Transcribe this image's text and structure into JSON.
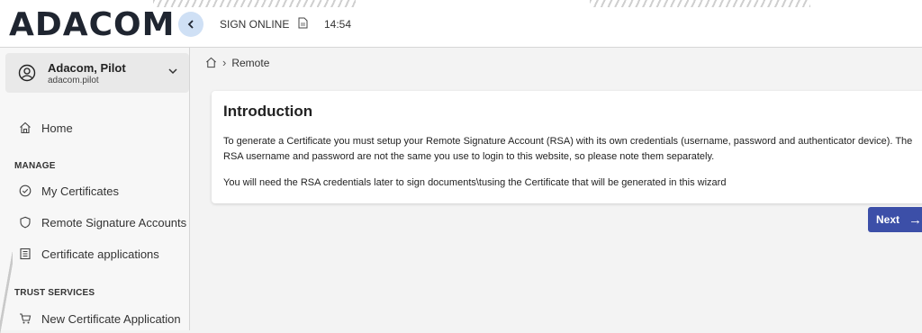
{
  "header": {
    "logo": "ADACOM",
    "label": "SIGN ONLINE",
    "time": "14:54"
  },
  "user": {
    "name": "Adacom, Pilot",
    "login": "adacom.pilot"
  },
  "sidebar": {
    "home": "Home",
    "manage_label": "MANAGE",
    "manage_items": [
      "My Certificates",
      "Remote Signature Accounts",
      "Certificate applications"
    ],
    "trust_label": "TRUST SERVICES",
    "trust_items": [
      "New Certificate Application"
    ]
  },
  "breadcrumb": {
    "current": "Remote"
  },
  "intro": {
    "title": "Introduction",
    "paragraph1": "To generate a Certificate you must setup your Remote Signature Account (RSA) with its own credentials (username, password and authenticator device). The RSA username and password are not the same you use to login to this website, so please note them separately.",
    "paragraph2": "You will need the RSA credentials later to sign documents\\tusing the Certificate that will be generated in this wizard"
  },
  "actions": {
    "next_label": "Next",
    "next_arrow": "→"
  },
  "colors": {
    "accent": "#3c4fa8",
    "collapse_bg": "#cfe0f5"
  }
}
